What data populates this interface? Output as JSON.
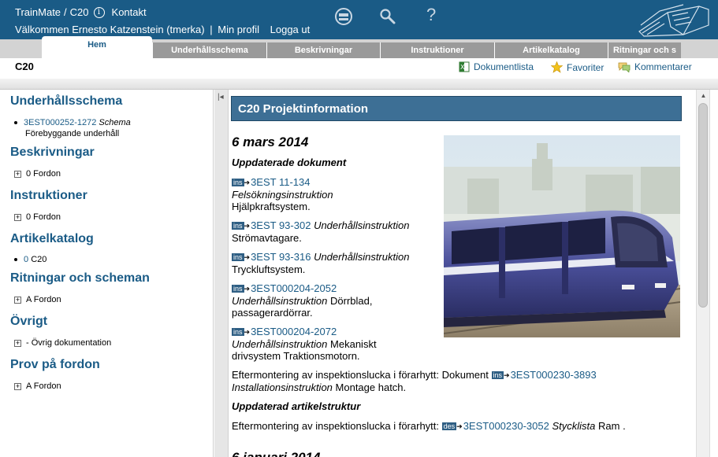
{
  "header": {
    "breadcrumb_app": "TrainMate",
    "breadcrumb_sep": "/",
    "breadcrumb_project": "C20",
    "contact": "Kontakt",
    "welcome": "Välkommen Ernesto Katzenstein (tmerka)",
    "sep": "|",
    "profile": "Min profil",
    "logout": "Logga ut",
    "help_icon_glyph": "?"
  },
  "tabs": [
    {
      "label": "Hem",
      "active": true
    },
    {
      "label": "Underhållsschema"
    },
    {
      "label": "Beskrivningar"
    },
    {
      "label": "Instruktioner"
    },
    {
      "label": "Artikelkatalog"
    },
    {
      "label": "Ritningar och s"
    }
  ],
  "subheader": {
    "page_code": "C20",
    "doclist": "Dokumentlista",
    "favorites": "Favoriter",
    "comments": "Kommentarer"
  },
  "sidebar": {
    "sections": [
      {
        "title": "Underhållsschema",
        "item_link": "3EST000252-1272",
        "item_italic": "Schema",
        "item_text2": "Förebyggande underhåll"
      },
      {
        "title": "Beskrivningar",
        "item": "0 Fordon"
      },
      {
        "title": "Instruktioner",
        "item": "0 Fordon"
      },
      {
        "title": "Artikelkatalog",
        "item_link": "0",
        "item_text": "C20"
      },
      {
        "title": "Ritningar och scheman",
        "item": "A Fordon"
      },
      {
        "title": "Övrigt",
        "item": "- Övrig dokumentation"
      },
      {
        "title": "Prov på fordon",
        "item": "A Fordon"
      }
    ]
  },
  "main": {
    "title": "C20 Projektinformation",
    "date": "6 mars 2014",
    "updated_docs_heading": "Uppdaterade dokument",
    "badge_ins": "ins",
    "badge_des": "des",
    "entries": [
      {
        "link": "3EST 11-134",
        "type": "Felsökningsinstruktion",
        "text": "Hjälpkraftsystem."
      },
      {
        "link": "3EST 93-302",
        "type": "Underhållsinstruktion",
        "text": "Strömavtagare."
      },
      {
        "link": "3EST 93-316",
        "type": "Underhållsinstruktion",
        "text": "Tryckluftsystem."
      },
      {
        "link": "3EST000204-2052",
        "type": "Underhållsinstruktion",
        "text": "Dörrblad,",
        "text2": "passagerardörrar."
      },
      {
        "link": "3EST000204-2072",
        "type": "Underhållsinstruktion",
        "text": "Mekaniskt",
        "text2": "drivsystem Traktionsmotorn."
      }
    ],
    "retrofit": {
      "prefix": "Eftermontering av inspektionslucka i förarhytt: Dokument",
      "link": "3EST000230-3893",
      "type": "Installationsinstruktion",
      "text": "Montage hatch."
    },
    "updated_struct_heading": "Uppdaterad artikelstruktur",
    "retrofit2": {
      "prefix": "Eftermontering av inspektionslucka i förarhytt:",
      "link": "3EST000230-3052",
      "type": "Stycklista",
      "text": "Ram ."
    },
    "next_date_partial": "6 januari 2014"
  },
  "colors": {
    "header_bg": "#1a5b86",
    "title_bg": "#3d6f95",
    "link": "#1a5b86"
  }
}
